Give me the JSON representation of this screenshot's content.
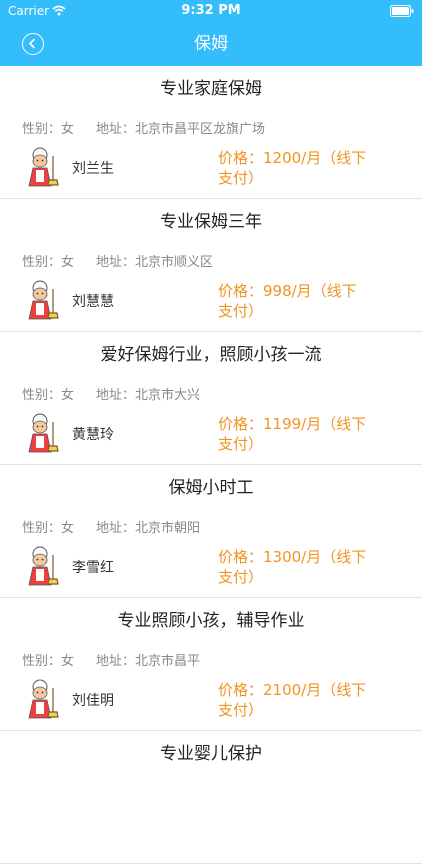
{
  "status_bar": {
    "carrier": "Carrier",
    "time": "9:32 PM"
  },
  "nav": {
    "title": "保姆",
    "back_icon": "back-arrow-circle-icon"
  },
  "colors": {
    "nav_bg": "#33bdfb",
    "price": "#f29421"
  },
  "listings": [
    {
      "title": "专业家庭保姆",
      "gender_label": "性别：",
      "gender": "女",
      "address_label": "地址：",
      "address": "北京市昌平区龙旗广场",
      "name": "刘兰生",
      "price_line1": "价格：1200/月（线下",
      "price_line2": "支付）"
    },
    {
      "title": "专业保姆三年",
      "gender_label": "性别：",
      "gender": "女",
      "address_label": "地址：",
      "address": "北京市顺义区",
      "name": "刘慧慧",
      "price_line1": "价格：998/月（线下",
      "price_line2": "支付）"
    },
    {
      "title": "爱好保姆行业，照顾小孩一流",
      "gender_label": "性别：",
      "gender": "女",
      "address_label": "地址：",
      "address": "北京市大兴",
      "name": "黄慧玲",
      "price_line1": "价格：1199/月（线下",
      "price_line2": "支付）"
    },
    {
      "title": "保姆小时工",
      "gender_label": "性别：",
      "gender": "女",
      "address_label": "地址：",
      "address": "北京市朝阳",
      "name": "李雪红",
      "price_line1": "价格：1300/月（线下",
      "price_line2": "支付）"
    },
    {
      "title": "专业照顾小孩，辅导作业",
      "gender_label": "性别：",
      "gender": "女",
      "address_label": "地址：",
      "address": "北京市昌平",
      "name": "刘佳明",
      "price_line1": "价格：2100/月（线下",
      "price_line2": "支付）"
    },
    {
      "title": "专业婴儿保护"
    }
  ]
}
